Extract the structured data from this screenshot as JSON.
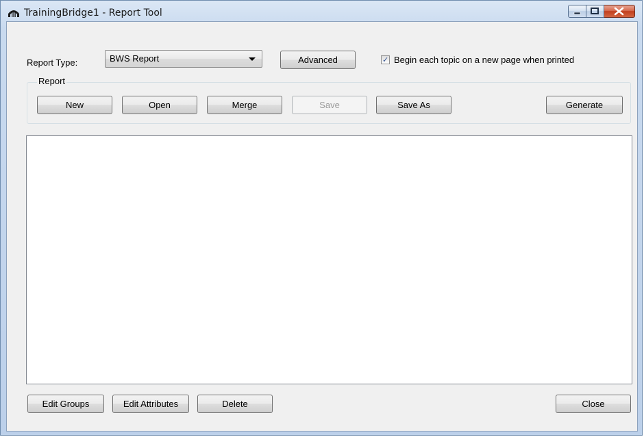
{
  "window": {
    "title": "TrainingBridge1 - Report Tool",
    "icon": "bridge-arch-icon"
  },
  "caption_buttons": {
    "minimize": "minimize-icon",
    "maximize": "maximize-icon",
    "close": "close-icon"
  },
  "report_type": {
    "label": "Report Type:",
    "selected": "BWS Report"
  },
  "toolbar": {
    "advanced_label": "Advanced",
    "new_page_checkbox_label": "Begin each topic on a new page when printed",
    "new_page_checked": true
  },
  "report_group": {
    "title": "Report",
    "new_label": "New",
    "open_label": "Open",
    "merge_label": "Merge",
    "save_label": "Save",
    "save_as_label": "Save As",
    "generate_label": "Generate"
  },
  "footer": {
    "edit_groups_label": "Edit Groups",
    "edit_attributes_label": "Edit Attributes",
    "delete_label": "Delete",
    "close_label": "Close"
  },
  "colors": {
    "frame": "#c9daef",
    "client_bg": "#f0f0f0",
    "close_button": "#c2401f"
  }
}
